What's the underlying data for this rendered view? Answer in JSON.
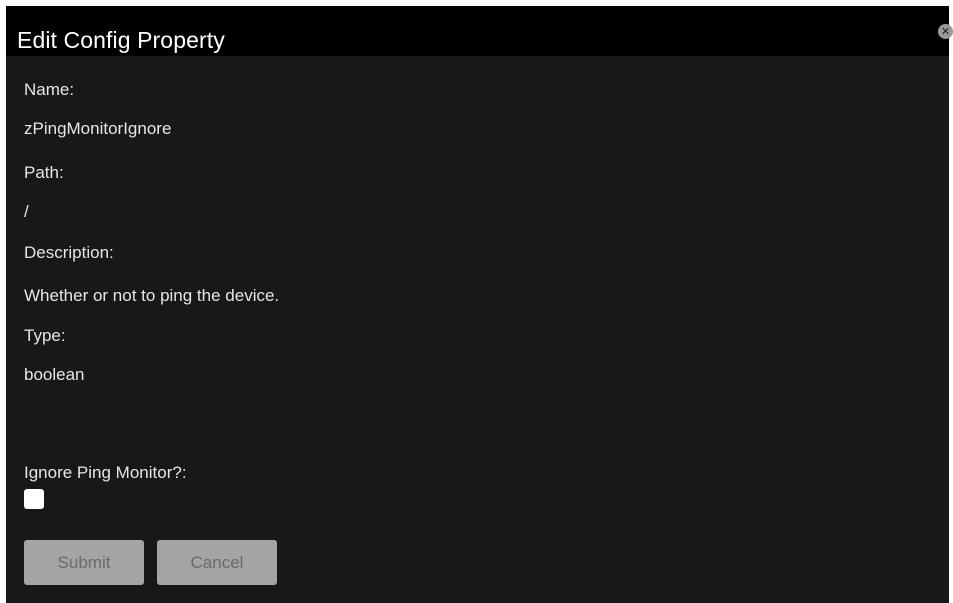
{
  "dialog": {
    "title": "Edit Config Property",
    "close_glyph": "✕"
  },
  "fields": {
    "name_label": "Name:",
    "name_value": "zPingMonitorIgnore",
    "path_label": "Path:",
    "path_value": "/",
    "description_label": "Description:",
    "description_value": "Whether or not to ping the device.",
    "type_label": "Type:",
    "type_value": "boolean"
  },
  "setting": {
    "label": "Ignore Ping Monitor?:",
    "checked": false
  },
  "buttons": {
    "submit_label": "Submit",
    "cancel_label": "Cancel"
  }
}
